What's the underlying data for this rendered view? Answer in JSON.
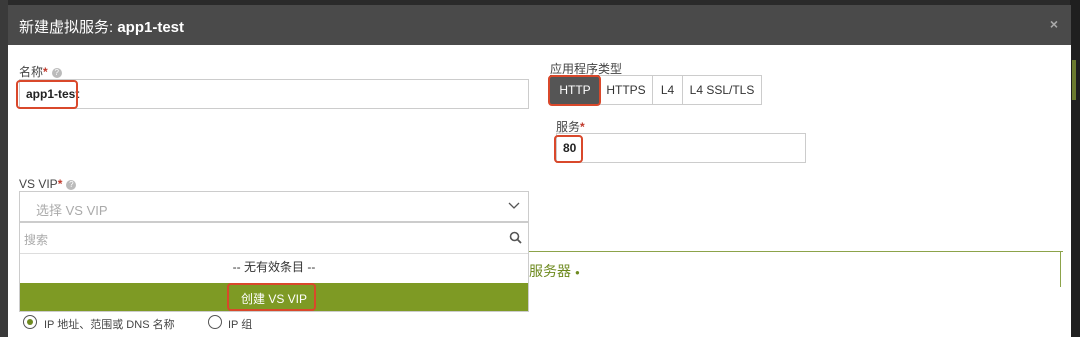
{
  "modal": {
    "title_prefix": "新建虚拟服务:",
    "title_name": "app1-test",
    "close_label": "×"
  },
  "form": {
    "name_label": "名称",
    "name_value": "app1-test",
    "app_type_label": "应用程序类型",
    "app_types": [
      "HTTP",
      "HTTPS",
      "L4",
      "L4 SSL/TLS"
    ],
    "app_type_selected": "HTTP",
    "service_label": "服务",
    "service_value": "80",
    "vs_vip_label": "VS VIP",
    "vs_vip_placeholder": "选择 VS VIP",
    "search_placeholder": "搜索",
    "no_items_text": "-- 无有效条目 --",
    "create_vip_label": "创建 VS VIP",
    "required_mark": "*",
    "help_mark": "?"
  },
  "servers": {
    "title_partial": "服务器",
    "radio_options": [
      {
        "label": "IP 地址、范围或 DNS 名称",
        "selected": true
      },
      {
        "label": "IP 组",
        "selected": false
      }
    ]
  },
  "colors": {
    "accent_green": "#7e9a24",
    "highlight_red": "#d9482b",
    "header_bg": "#4a4a4a"
  }
}
